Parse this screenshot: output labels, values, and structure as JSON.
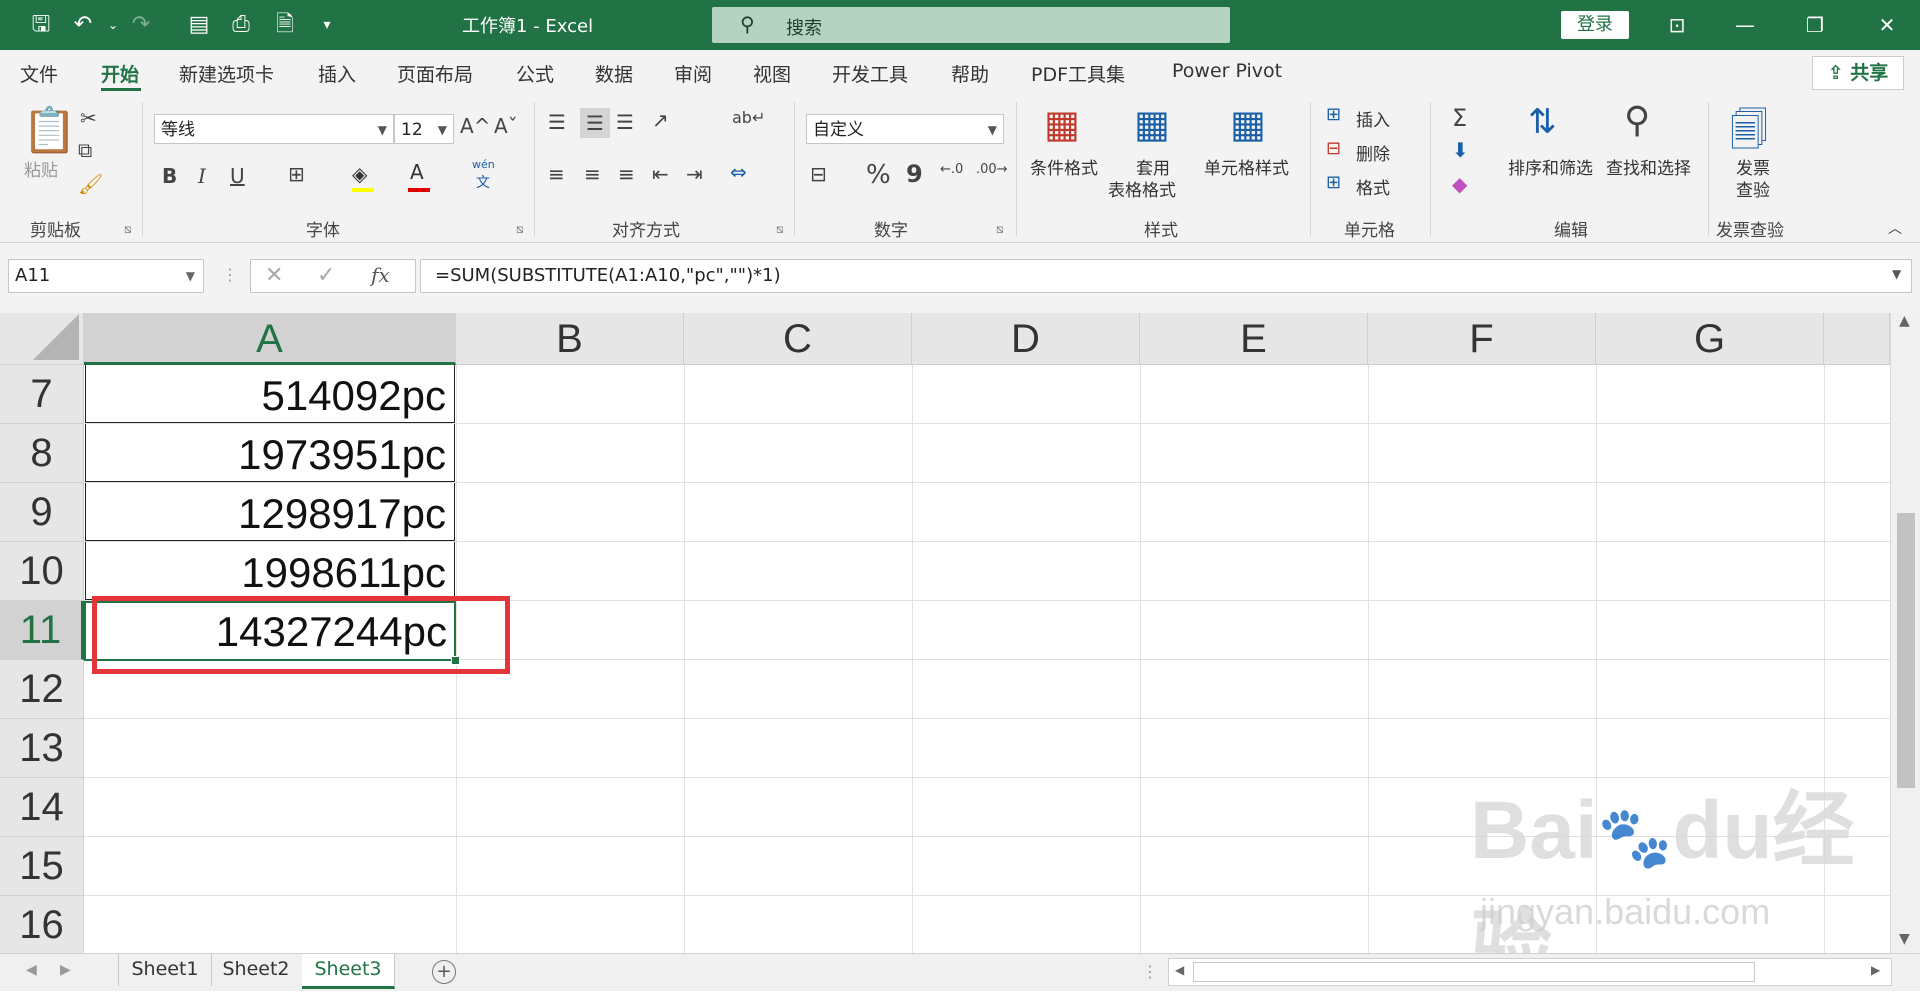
{
  "window": {
    "title": "工作簿1 - Excel",
    "search_placeholder": "搜索",
    "login": "登录"
  },
  "menu": {
    "tabs": [
      "文件",
      "开始",
      "新建选项卡",
      "插入",
      "页面布局",
      "公式",
      "数据",
      "审阅",
      "视图",
      "开发工具",
      "帮助",
      "PDF工具集",
      "Power Pivot"
    ],
    "active": "开始",
    "share": "共享"
  },
  "ribbon": {
    "clipboard": {
      "label": "剪贴板",
      "paste": "粘贴"
    },
    "font": {
      "label": "字体",
      "name": "等线",
      "size": "12",
      "bold": "B",
      "italic": "I",
      "underline": "U",
      "increase": "A",
      "decrease": "A",
      "phonetic_top": "wén",
      "phonetic_bottom": "文"
    },
    "alignment": {
      "label": "对齐方式"
    },
    "number": {
      "label": "数字",
      "format": "自定义",
      "percent": "%",
      "comma": "9"
    },
    "styles": {
      "label": "样式",
      "conditional": "条件格式",
      "table_line1": "套用",
      "table_line2": "表格格式",
      "cell_styles": "单元格样式"
    },
    "cells": {
      "label": "单元格",
      "insert": "插入",
      "delete": "删除",
      "format": "格式"
    },
    "editing": {
      "label": "编辑",
      "sort": "排序和筛选",
      "find": "查找和选择"
    },
    "invoice": {
      "label": "发票查验",
      "line1": "发票",
      "line2": "查验"
    }
  },
  "formula_bar": {
    "name_box": "A11",
    "fx": "fx",
    "formula": "=SUM(SUBSTITUTE(A1:A10,\"pc\",\"\")*1)"
  },
  "grid": {
    "columns": [
      "A",
      "B",
      "C",
      "D",
      "E",
      "F",
      "G"
    ],
    "rows": [
      {
        "num": "7",
        "a": "514092pc"
      },
      {
        "num": "8",
        "a": "1973951pc"
      },
      {
        "num": "9",
        "a": "1298917pc"
      },
      {
        "num": "10",
        "a": "1998611pc"
      },
      {
        "num": "11",
        "a": "14327244pc"
      },
      {
        "num": "12",
        "a": ""
      },
      {
        "num": "13",
        "a": ""
      },
      {
        "num": "14",
        "a": ""
      },
      {
        "num": "15",
        "a": ""
      },
      {
        "num": "16",
        "a": ""
      }
    ],
    "active_cell": "A11"
  },
  "sheets": {
    "tabs": [
      "Sheet1",
      "Sheet2",
      "Sheet3"
    ],
    "active": "Sheet3"
  },
  "watermark": {
    "brand": "Bai",
    "brand2": "du",
    "cn": "经验",
    "url": "jingyan.baidu.com"
  },
  "colors": {
    "accent": "#217346",
    "highlight": "#e3353a"
  }
}
